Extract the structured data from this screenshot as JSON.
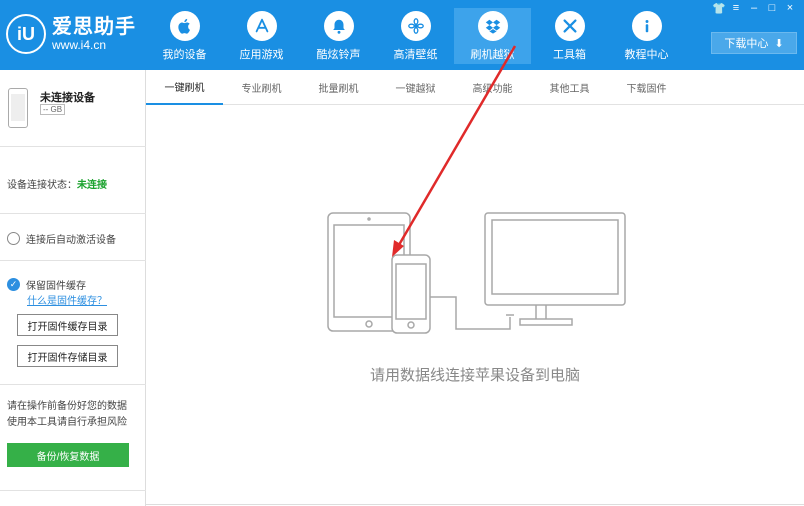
{
  "app": {
    "logo_mark": "iU",
    "name": "爱思助手",
    "url": "www.i4.cn"
  },
  "nav": [
    {
      "label": "我的设备",
      "icon": "apple-icon"
    },
    {
      "label": "应用游戏",
      "icon": "app-store-icon"
    },
    {
      "label": "酷炫铃声",
      "icon": "bell-icon"
    },
    {
      "label": "高清壁纸",
      "icon": "flower-icon"
    },
    {
      "label": "刷机越狱",
      "icon": "dropbox-icon"
    },
    {
      "label": "工具箱",
      "icon": "tools-icon"
    },
    {
      "label": "教程中心",
      "icon": "info-icon"
    }
  ],
  "window": {
    "download_center": "下载中心",
    "controls": [
      "👕",
      "≡",
      "–",
      "□",
      "×"
    ]
  },
  "sidebar": {
    "device_name": "未连接设备",
    "device_capacity": "-- GB",
    "status_label": "设备连接状态：",
    "status_value": "未连接",
    "auto_activate": "连接后自动激活设备",
    "keep_cache": "保留固件缓存",
    "what_is_cache": "什么是固件缓存？",
    "open_cache_dir": "打开固件缓存目录",
    "open_storage_dir": "打开固件存储目录",
    "warning_line1": "请在操作前备份好您的数据",
    "warning_line2": "使用本工具请自行承担风险",
    "backup_button": "备份/恢复数据"
  },
  "tabs": [
    "一键刷机",
    "专业刷机",
    "批量刷机",
    "一键越狱",
    "高级功能",
    "其他工具",
    "下载固件"
  ],
  "main": {
    "message": "请用数据线连接苹果设备到电脑"
  },
  "colors": {
    "brand": "#1a8fe3",
    "status_green": "#1aa22d",
    "button_green": "#35b048",
    "annotation_arrow": "#e02a2a"
  }
}
